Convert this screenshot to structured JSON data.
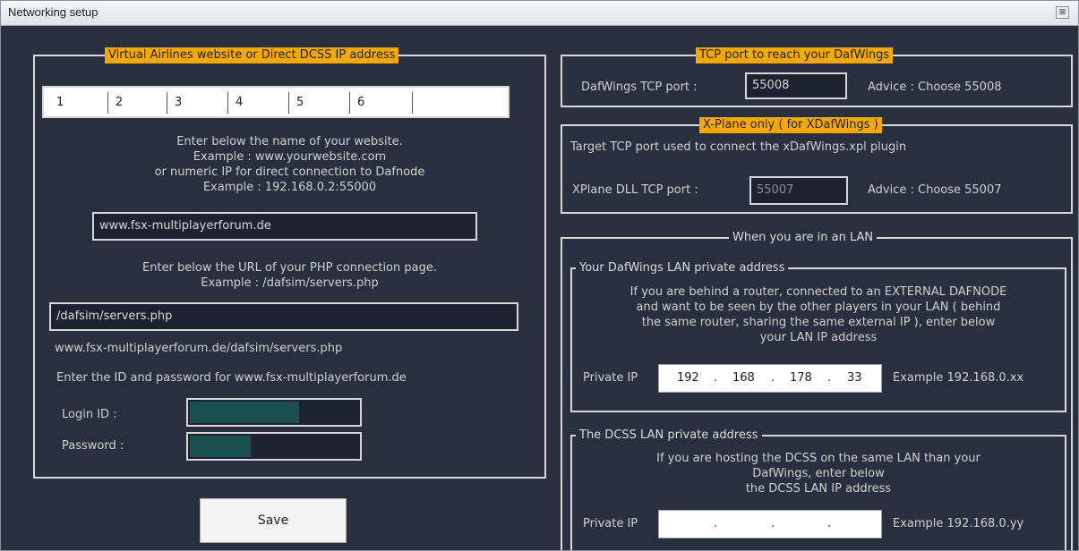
{
  "window": {
    "title": "Networking setup",
    "close_glyph": "⊠"
  },
  "left": {
    "legend": "Virtual Airlines website or Direct DCSS IP address",
    "tabs": [
      {
        "label": "1"
      },
      {
        "label": "2"
      },
      {
        "label": "3"
      },
      {
        "label": "4"
      },
      {
        "label": "5"
      },
      {
        "label": "6"
      }
    ],
    "website_instructions": [
      "Enter below the name of your website.",
      "Example :  www.yourwebsite.com",
      "or numeric IP for direct connection to Dafnode",
      "Example : 192.168.0.2:55000"
    ],
    "website_value": "www.fsx-multiplayerforum.de",
    "url_instructions": [
      "Enter below the URL of your PHP connection page.",
      "Example :  /dafsim/servers.php"
    ],
    "url_value": "/dafsim/servers.php",
    "full_url": "www.fsx-multiplayerforum.de/dafsim/servers.php",
    "credentials_prompt": "Enter the ID and password for www.fsx-multiplayerforum.de",
    "login_label": "Login ID :",
    "password_label": "Password :",
    "save_label": "Save"
  },
  "tcp": {
    "legend": "TCP port to reach your DafWings",
    "label": "DafWings TCP port :",
    "value": "55008",
    "advice": "Advice : Choose 55008"
  },
  "xplane": {
    "legend": "X-Plane only ( for XDafWings )",
    "description": "Target TCP port used to connect the  xDafWings.xpl  plugin",
    "label": "XPlane DLL TCP port :",
    "value": "55007",
    "advice": "Advice : Choose 55007"
  },
  "lan": {
    "legend": "When you are in an LAN",
    "dafwings": {
      "legend": "Your DafWings LAN private address",
      "text": [
        "If you are behind a router, connected to an EXTERNAL DAFNODE",
        "and want to be seen by the other players in your LAN ( behind",
        "the same router, sharing the same external IP ), enter below",
        "your LAN IP address"
      ],
      "ip_label": "Private IP",
      "ip": [
        "192",
        "168",
        "178",
        "33"
      ],
      "example": "Example 192.168.0.xx"
    },
    "dcss": {
      "legend": "The DCSS LAN private address",
      "text": [
        "If you are hosting the DCSS on the same LAN than your",
        "DafWings, enter below",
        "the DCSS LAN IP address"
      ],
      "ip_label": "Private IP",
      "ip": [
        "",
        "",
        "",
        ""
      ],
      "example": "Example 192.168.0.yy"
    }
  }
}
